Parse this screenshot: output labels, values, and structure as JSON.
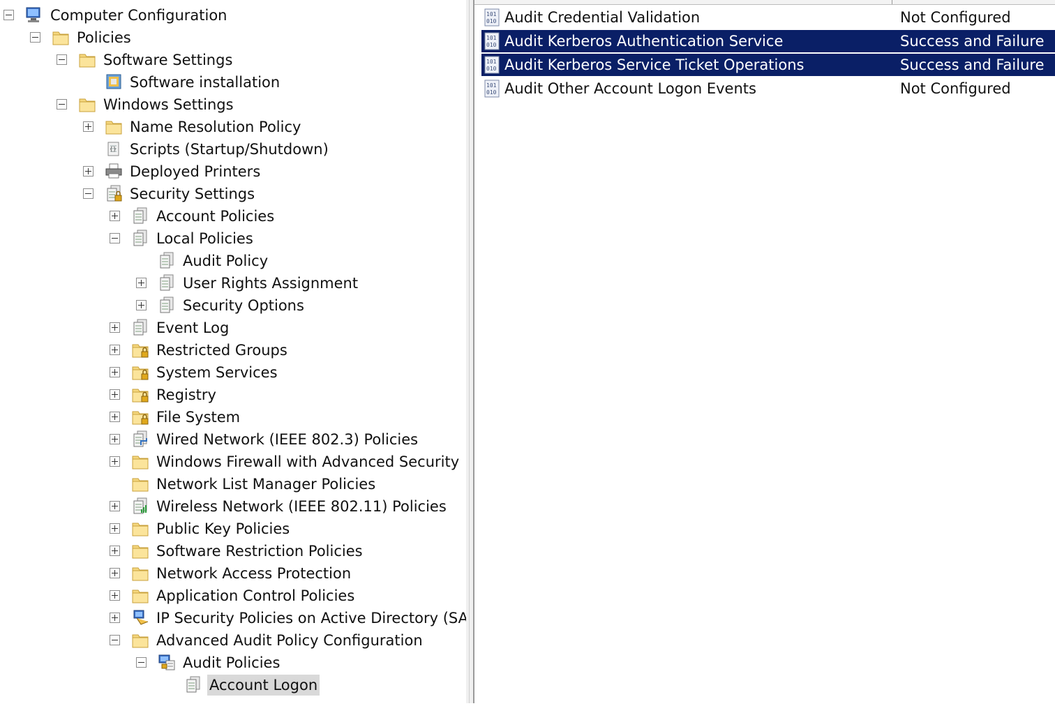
{
  "tree": {
    "items": [
      {
        "label": "Computer Configuration",
        "icon": "computer-icon",
        "expander": "minus"
      },
      {
        "label": "Policies",
        "icon": "folder-icon",
        "expander": "minus"
      },
      {
        "label": "Software Settings",
        "icon": "folder-icon",
        "expander": "minus"
      },
      {
        "label": "Software installation",
        "icon": "software-installation-icon",
        "expander": "none"
      },
      {
        "label": "Windows Settings",
        "icon": "folder-icon",
        "expander": "minus"
      },
      {
        "label": "Name Resolution Policy",
        "icon": "folder-icon",
        "expander": "plus"
      },
      {
        "label": "Scripts (Startup/Shutdown)",
        "icon": "script-icon",
        "expander": "none"
      },
      {
        "label": "Deployed Printers",
        "icon": "printer-icon",
        "expander": "plus"
      },
      {
        "label": "Security Settings",
        "icon": "security-settings-icon",
        "expander": "minus"
      },
      {
        "label": "Account Policies",
        "icon": "policy-icon",
        "expander": "plus"
      },
      {
        "label": "Local Policies",
        "icon": "policy-icon",
        "expander": "minus"
      },
      {
        "label": "Audit Policy",
        "icon": "policy-icon",
        "expander": "none"
      },
      {
        "label": "User Rights Assignment",
        "icon": "policy-icon",
        "expander": "plus"
      },
      {
        "label": "Security Options",
        "icon": "policy-icon",
        "expander": "plus"
      },
      {
        "label": "Event Log",
        "icon": "policy-icon",
        "expander": "plus"
      },
      {
        "label": "Restricted Groups",
        "icon": "locked-folder-icon",
        "expander": "plus"
      },
      {
        "label": "System Services",
        "icon": "locked-folder-icon",
        "expander": "plus"
      },
      {
        "label": "Registry",
        "icon": "locked-folder-icon",
        "expander": "plus"
      },
      {
        "label": "File System",
        "icon": "locked-folder-icon",
        "expander": "plus"
      },
      {
        "label": "Wired Network (IEEE 802.3) Policies",
        "icon": "wired-network-icon",
        "expander": "plus"
      },
      {
        "label": "Windows Firewall with Advanced Security",
        "icon": "folder-icon",
        "expander": "plus"
      },
      {
        "label": "Network List Manager Policies",
        "icon": "folder-icon",
        "expander": "none"
      },
      {
        "label": "Wireless Network (IEEE 802.11) Policies",
        "icon": "wireless-network-icon",
        "expander": "plus"
      },
      {
        "label": "Public Key Policies",
        "icon": "folder-icon",
        "expander": "plus"
      },
      {
        "label": "Software Restriction Policies",
        "icon": "folder-icon",
        "expander": "plus"
      },
      {
        "label": "Network Access Protection",
        "icon": "folder-icon",
        "expander": "plus"
      },
      {
        "label": "Application Control Policies",
        "icon": "folder-icon",
        "expander": "plus"
      },
      {
        "label": "IP Security Policies on Active Directory (SANDS",
        "icon": "ip-security-icon",
        "expander": "plus"
      },
      {
        "label": "Advanced Audit Policy Configuration",
        "icon": "folder-icon",
        "expander": "minus"
      },
      {
        "label": "Audit Policies",
        "icon": "audit-policies-icon",
        "expander": "minus"
      },
      {
        "label": "Account Logon",
        "icon": "policy-icon",
        "expander": "none",
        "selected": true
      }
    ]
  },
  "details": {
    "rows": [
      {
        "name": "Audit Credential Validation",
        "value": "Not Configured",
        "selected": false,
        "icon": "audit-setting-icon"
      },
      {
        "name": "Audit Kerberos Authentication Service",
        "value": "Success and Failure",
        "selected": true,
        "icon": "audit-setting-icon"
      },
      {
        "name": "Audit Kerberos Service Ticket Operations",
        "value": "Success and Failure",
        "selected": true,
        "icon": "audit-setting-icon"
      },
      {
        "name": "Audit Other Account Logon Events",
        "value": "Not Configured",
        "selected": false,
        "icon": "audit-setting-icon"
      }
    ]
  },
  "colors": {
    "selection": "#0a1f66",
    "tree_selection": "#d9d9d9",
    "folder": "#f5d77e"
  }
}
